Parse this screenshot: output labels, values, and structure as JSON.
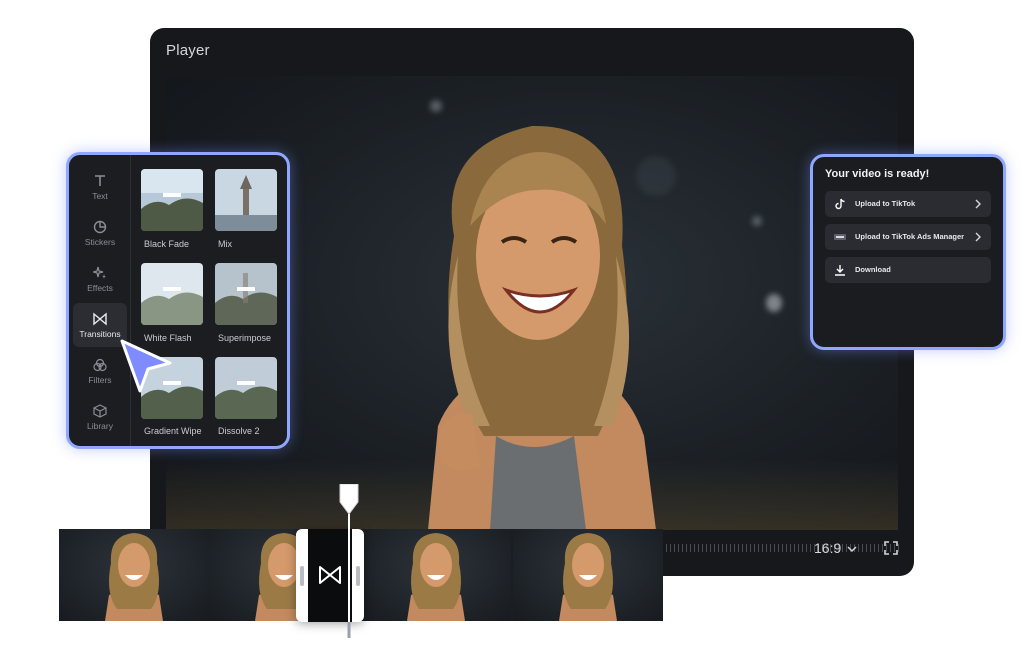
{
  "player": {
    "title": "Player",
    "aspect_ratio_label": "16:9",
    "aspect_ratio_icon": "chevron-down-icon",
    "fullscreen_icon": "fullscreen-icon"
  },
  "tools": [
    {
      "label": "Text",
      "icon": "text-icon"
    },
    {
      "label": "Stickers",
      "icon": "sticker-icon"
    },
    {
      "label": "Effects",
      "icon": "sparkle-icon"
    },
    {
      "label": "Transitions",
      "icon": "bowtie-icon",
      "active": true
    },
    {
      "label": "Filters",
      "icon": "filters-icon"
    },
    {
      "label": "Library",
      "icon": "cube-icon"
    }
  ],
  "transitions": [
    {
      "label": "Black Fade"
    },
    {
      "label": "Mix"
    },
    {
      "label": "White Flash"
    },
    {
      "label": "Superimpose"
    },
    {
      "label": "Gradient Wipe"
    },
    {
      "label": "Dissolve 2"
    }
  ],
  "export_panel": {
    "title": "Your video is ready!",
    "actions": [
      {
        "label": "Upload to TikTok",
        "icon": "tiktok-icon"
      },
      {
        "label": "Upload to TikTok Ads Manager",
        "icon": "tiktok-ads-icon"
      },
      {
        "label": "Download",
        "icon": "download-icon"
      }
    ]
  },
  "colors": {
    "accent": "#8fa7ff",
    "panel_bg": "#1c1d21",
    "cursor": "#7f8cff"
  }
}
